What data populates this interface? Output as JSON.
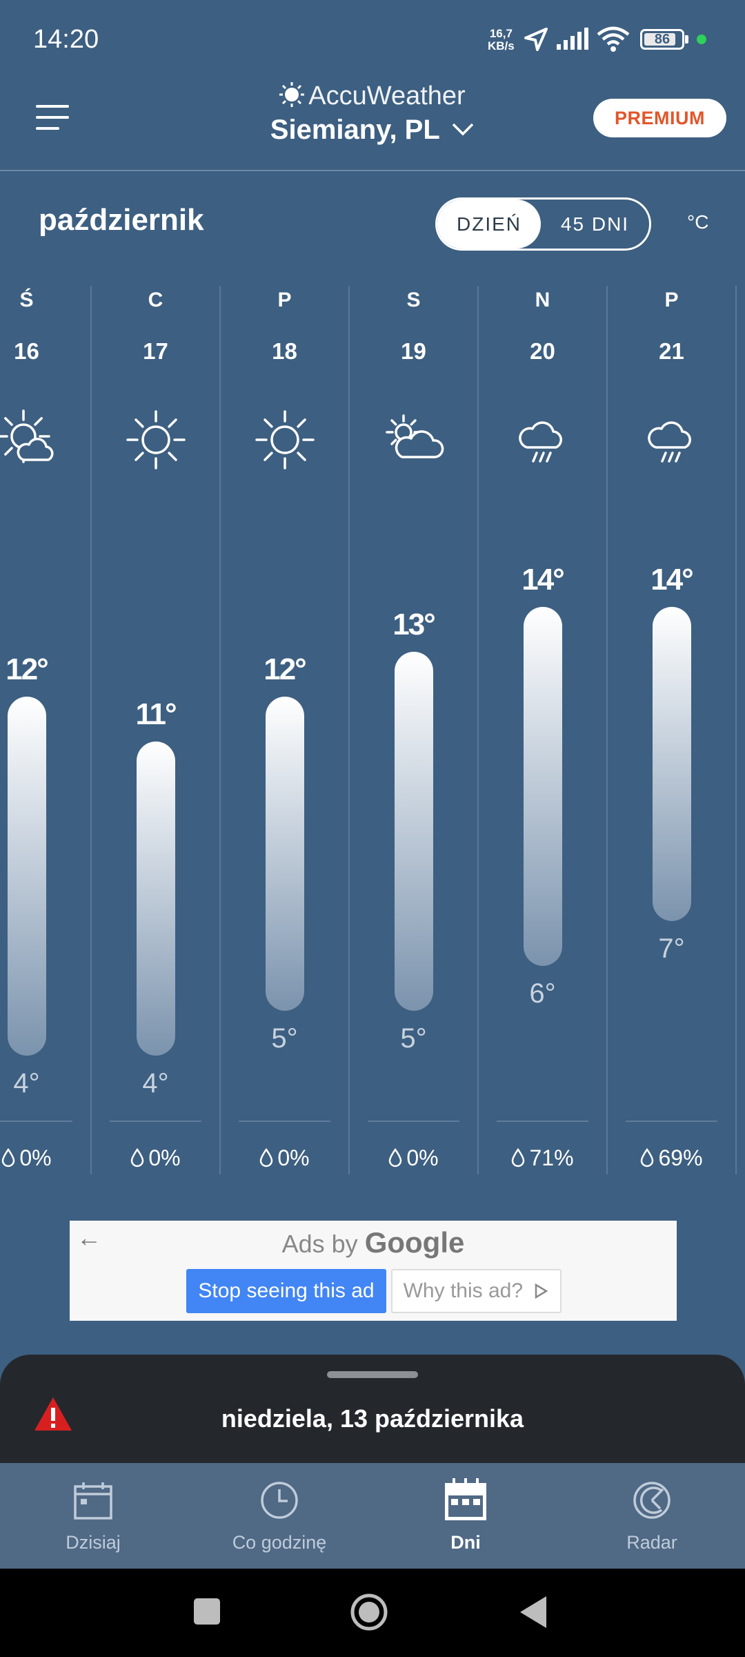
{
  "status_bar": {
    "time": "14:20",
    "net_speed_value": "16,7",
    "net_speed_unit": "KB/s",
    "battery": "86",
    "battery_level_percent": 86,
    "icons": [
      "location-arrow-icon",
      "signal-icon",
      "wifi-icon",
      "battery-icon",
      "green-dot-icon"
    ]
  },
  "header": {
    "brand": "AccuWeather",
    "location": "Siemiany, PL",
    "premium_label": "PREMIUM"
  },
  "controls": {
    "month": "październik",
    "toggle_active": "DZIEŃ",
    "toggle_inactive": "45 DNI",
    "unit": "°C"
  },
  "days": [
    {
      "letter": "Ś",
      "date": "16",
      "icon": "partly-sunny-icon",
      "high": "12°",
      "low": "4°",
      "precip": "0%",
      "high_value": 12,
      "low_value": 4
    },
    {
      "letter": "C",
      "date": "17",
      "icon": "sunny-icon",
      "high": "11°",
      "low": "4°",
      "precip": "0%",
      "high_value": 11,
      "low_value": 4
    },
    {
      "letter": "P",
      "date": "18",
      "icon": "sunny-icon",
      "high": "12°",
      "low": "5°",
      "precip": "0%",
      "high_value": 12,
      "low_value": 5
    },
    {
      "letter": "S",
      "date": "19",
      "icon": "partly-cloudy-icon",
      "high": "13°",
      "low": "5°",
      "precip": "0%",
      "high_value": 13,
      "low_value": 5
    },
    {
      "letter": "N",
      "date": "20",
      "icon": "rain-icon",
      "high": "14°",
      "low": "6°",
      "precip": "71%",
      "high_value": 14,
      "low_value": 6
    },
    {
      "letter": "P",
      "date": "21",
      "icon": "rain-icon",
      "high": "14°",
      "low": "7°",
      "precip": "69%",
      "high_value": 14,
      "low_value": 7
    }
  ],
  "ad": {
    "prefix": "Ads by",
    "brand": "Google",
    "stop_label": "Stop seeing this ad",
    "why_label": "Why this ad?"
  },
  "sheet": {
    "date": "niedziela, 13 października"
  },
  "nav": {
    "items": [
      {
        "label": "Dzisiaj",
        "icon": "calendar-icon"
      },
      {
        "label": "Co godzinę",
        "icon": "clock-icon"
      },
      {
        "label": "Dni",
        "icon": "calendar-grid-icon",
        "active": true
      },
      {
        "label": "Radar",
        "icon": "radar-icon"
      }
    ]
  },
  "colors": {
    "background": "#3d5f81",
    "premium_text": "#e2562b",
    "sheet": "#24282d",
    "nav": "#506985",
    "ad_button": "#4285f4",
    "alert": "#d81f1f"
  }
}
